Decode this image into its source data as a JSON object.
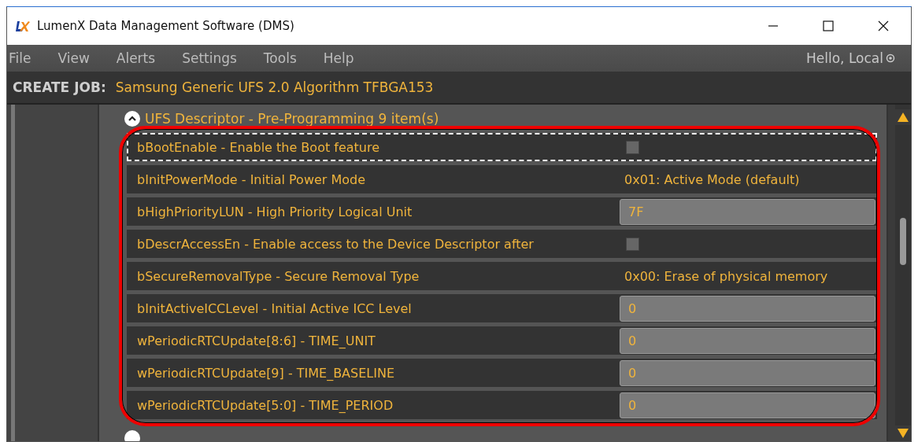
{
  "window": {
    "title": "LumenX Data Management Software (DMS)"
  },
  "menu": [
    "File",
    "View",
    "Alerts",
    "Settings",
    "Tools",
    "Help"
  ],
  "user": "Hello, Local",
  "job": {
    "label": "CREATE JOB:",
    "value": "Samsung Generic UFS 2.0 Algorithm TFBGA153"
  },
  "section": {
    "title": "UFS Descriptor - Pre-Programming 9 item(s)",
    "expanded": true,
    "rows": [
      {
        "label": "bBootEnable - Enable the Boot feature",
        "kind": "checkbox",
        "checked": false,
        "focused": true
      },
      {
        "label": "bInitPowerMode - Initial Power Mode",
        "kind": "text",
        "value": "0x01: Active Mode (default)",
        "focused": false
      },
      {
        "label": "bHighPriorityLUN - High Priority Logical Unit",
        "kind": "input",
        "value": "7F",
        "focused": false
      },
      {
        "label": "bDescrAccessEn - Enable access to the Device Descriptor after",
        "kind": "checkbox",
        "checked": false,
        "focused": false
      },
      {
        "label": "bSecureRemovalType - Secure Removal Type",
        "kind": "text",
        "value": "0x00: Erase of physical memory",
        "focused": false
      },
      {
        "label": "bInitActiveICCLevel - Initial Active ICC Level",
        "kind": "input",
        "value": "0",
        "focused": false
      },
      {
        "label": "wPeriodicRTCUpdate[8:6] - TIME_UNIT",
        "kind": "input",
        "value": "0",
        "focused": false
      },
      {
        "label": "wPeriodicRTCUpdate[9] - TIME_BASELINE",
        "kind": "input",
        "value": "0",
        "focused": false
      },
      {
        "label": "wPeriodicRTCUpdate[5:0] - TIME_PERIOD",
        "kind": "input",
        "value": "0",
        "focused": false
      }
    ]
  }
}
